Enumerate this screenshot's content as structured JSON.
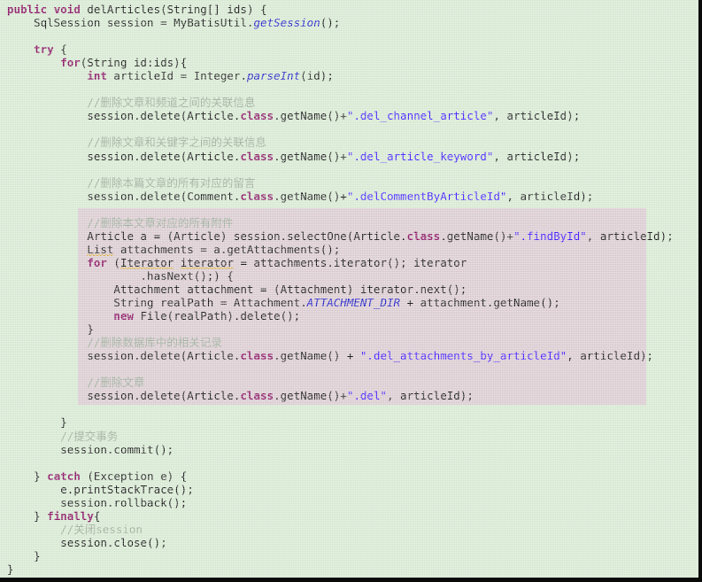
{
  "editor": {
    "language": "Java",
    "background_color": "#d2e6cd",
    "highlight_color": "#d6c6cc",
    "keyword_color": "#7f0055",
    "comment_color": "#90a48f",
    "string_color": "#2a00ff",
    "static_field_color": "#0000c0"
  },
  "code": {
    "lines": [
      {
        "id": 1,
        "indent": 0,
        "highlight": false,
        "tokens": [
          {
            "t": "kw",
            "v": "public"
          },
          {
            "t": "plain",
            "v": " "
          },
          {
            "t": "kw",
            "v": "void"
          },
          {
            "t": "plain",
            "v": " delArticles(String[] ids) {"
          }
        ]
      },
      {
        "id": 2,
        "indent": 1,
        "highlight": false,
        "tokens": [
          {
            "t": "plain",
            "v": "SqlSession session = MyBatisUtil."
          },
          {
            "t": "static",
            "v": "getSession"
          },
          {
            "t": "plain",
            "v": "();"
          }
        ]
      },
      {
        "id": 3,
        "indent": 0,
        "highlight": false,
        "tokens": []
      },
      {
        "id": 4,
        "indent": 1,
        "highlight": false,
        "tokens": [
          {
            "t": "kw",
            "v": "try"
          },
          {
            "t": "plain",
            "v": " {"
          }
        ]
      },
      {
        "id": 5,
        "indent": 2,
        "highlight": false,
        "tokens": [
          {
            "t": "kw",
            "v": "for"
          },
          {
            "t": "plain",
            "v": "(String id:ids){"
          }
        ]
      },
      {
        "id": 6,
        "indent": 3,
        "highlight": false,
        "tokens": [
          {
            "t": "kw",
            "v": "int"
          },
          {
            "t": "plain",
            "v": " articleId = Integer."
          },
          {
            "t": "static",
            "v": "parseInt"
          },
          {
            "t": "plain",
            "v": "(id);"
          }
        ]
      },
      {
        "id": 7,
        "indent": 0,
        "highlight": false,
        "tokens": []
      },
      {
        "id": 8,
        "indent": 3,
        "highlight": false,
        "tokens": [
          {
            "t": "cmt",
            "v": "//删除文章和频道之间的关联信息"
          }
        ]
      },
      {
        "id": 9,
        "indent": 3,
        "highlight": false,
        "tokens": [
          {
            "t": "plain",
            "v": "session.delete(Article."
          },
          {
            "t": "kw",
            "v": "class"
          },
          {
            "t": "plain",
            "v": ".getName()+"
          },
          {
            "t": "str",
            "v": "\".del_channel_article\""
          },
          {
            "t": "plain",
            "v": ", articleId);"
          }
        ]
      },
      {
        "id": 10,
        "indent": 0,
        "highlight": false,
        "tokens": []
      },
      {
        "id": 11,
        "indent": 3,
        "highlight": false,
        "tokens": [
          {
            "t": "cmt",
            "v": "//删除文章和关键字之间的关联信息"
          }
        ]
      },
      {
        "id": 12,
        "indent": 3,
        "highlight": false,
        "tokens": [
          {
            "t": "plain",
            "v": "session.delete(Article."
          },
          {
            "t": "kw",
            "v": "class"
          },
          {
            "t": "plain",
            "v": ".getName()+"
          },
          {
            "t": "str",
            "v": "\".del_article_keyword\""
          },
          {
            "t": "plain",
            "v": ", articleId);"
          }
        ]
      },
      {
        "id": 13,
        "indent": 0,
        "highlight": false,
        "tokens": []
      },
      {
        "id": 14,
        "indent": 3,
        "highlight": false,
        "tokens": [
          {
            "t": "cmt",
            "v": "//删除本篇文章的所有对应的留言"
          }
        ]
      },
      {
        "id": 15,
        "indent": 3,
        "highlight": false,
        "tokens": [
          {
            "t": "plain",
            "v": "session.delete(Comment."
          },
          {
            "t": "kw",
            "v": "class"
          },
          {
            "t": "plain",
            "v": ".getName()+"
          },
          {
            "t": "str",
            "v": "\".delCommentByArticleId\""
          },
          {
            "t": "plain",
            "v": ", articleId);"
          }
        ]
      },
      {
        "id": 16,
        "indent": 0,
        "highlight": true,
        "tokens": []
      },
      {
        "id": 17,
        "indent": 3,
        "highlight": true,
        "tokens": [
          {
            "t": "cmt",
            "v": "//删除本文章对应的所有附件"
          }
        ]
      },
      {
        "id": 18,
        "indent": 3,
        "highlight": true,
        "tokens": [
          {
            "t": "plain",
            "v": "Article a = (Article) session.selectOne(Article."
          },
          {
            "t": "kw",
            "v": "class"
          },
          {
            "t": "plain",
            "v": ".getName()+"
          },
          {
            "t": "str",
            "v": "\".findById\""
          },
          {
            "t": "plain",
            "v": ", articleId);"
          }
        ]
      },
      {
        "id": 19,
        "indent": 3,
        "highlight": true,
        "tokens": [
          {
            "t": "warn",
            "v": "List"
          },
          {
            "t": "plain",
            "v": " attachments = a.getAttachments();"
          }
        ]
      },
      {
        "id": 20,
        "indent": 3,
        "highlight": true,
        "tokens": [
          {
            "t": "kw",
            "v": "for"
          },
          {
            "t": "plain",
            "v": " ("
          },
          {
            "t": "warn",
            "v": "Iterator"
          },
          {
            "t": "plain",
            "v": " "
          },
          {
            "t": "warn",
            "v": "iterator"
          },
          {
            "t": "plain",
            "v": " = attachments.iterator(); iterator"
          }
        ]
      },
      {
        "id": 21,
        "indent": 5,
        "highlight": true,
        "tokens": [
          {
            "t": "plain",
            "v": ".hasNext();) {"
          }
        ]
      },
      {
        "id": 22,
        "indent": 4,
        "highlight": true,
        "tokens": [
          {
            "t": "plain",
            "v": "Attachment attachment = (Attachment) iterator.next();"
          }
        ]
      },
      {
        "id": 23,
        "indent": 4,
        "highlight": true,
        "tokens": [
          {
            "t": "plain",
            "v": "String realPath = Attachment."
          },
          {
            "t": "static",
            "v": "ATTACHMENT_DIR"
          },
          {
            "t": "plain",
            "v": " + attachment.getName();"
          }
        ]
      },
      {
        "id": 24,
        "indent": 4,
        "highlight": true,
        "tokens": [
          {
            "t": "kw",
            "v": "new"
          },
          {
            "t": "plain",
            "v": " File(realPath).delete();"
          }
        ]
      },
      {
        "id": 25,
        "indent": 3,
        "highlight": true,
        "tokens": [
          {
            "t": "plain",
            "v": "}"
          }
        ]
      },
      {
        "id": 26,
        "indent": 3,
        "highlight": true,
        "tokens": [
          {
            "t": "cmt",
            "v": "//删除数据库中的相关记录"
          }
        ]
      },
      {
        "id": 27,
        "indent": 3,
        "highlight": true,
        "tokens": [
          {
            "t": "plain",
            "v": "session.delete(Article."
          },
          {
            "t": "kw",
            "v": "class"
          },
          {
            "t": "plain",
            "v": ".getName() + "
          },
          {
            "t": "str",
            "v": "\".del_attachments_by_articleId\""
          },
          {
            "t": "plain",
            "v": ", articleId);"
          }
        ]
      },
      {
        "id": 28,
        "indent": 0,
        "highlight": true,
        "tokens": []
      },
      {
        "id": 29,
        "indent": 3,
        "highlight": true,
        "tokens": [
          {
            "t": "cmt",
            "v": "//删除文章"
          }
        ]
      },
      {
        "id": 30,
        "indent": 3,
        "highlight": true,
        "tokens": [
          {
            "t": "plain",
            "v": "session.delete(Article."
          },
          {
            "t": "kw",
            "v": "class"
          },
          {
            "t": "plain",
            "v": ".getName()+"
          },
          {
            "t": "str",
            "v": "\".del\""
          },
          {
            "t": "plain",
            "v": ", articleId);"
          }
        ]
      },
      {
        "id": 31,
        "indent": 0,
        "highlight": false,
        "tokens": []
      },
      {
        "id": 32,
        "indent": 2,
        "highlight": false,
        "tokens": [
          {
            "t": "plain",
            "v": "}"
          }
        ]
      },
      {
        "id": 33,
        "indent": 2,
        "highlight": false,
        "tokens": [
          {
            "t": "cmt",
            "v": "//提交事务"
          }
        ]
      },
      {
        "id": 34,
        "indent": 2,
        "highlight": false,
        "tokens": [
          {
            "t": "plain",
            "v": "session.commit();"
          }
        ]
      },
      {
        "id": 35,
        "indent": 0,
        "highlight": false,
        "tokens": []
      },
      {
        "id": 36,
        "indent": 1,
        "highlight": false,
        "tokens": [
          {
            "t": "plain",
            "v": "} "
          },
          {
            "t": "kw",
            "v": "catch"
          },
          {
            "t": "plain",
            "v": " (Exception e) {"
          }
        ]
      },
      {
        "id": 37,
        "indent": 2,
        "highlight": false,
        "tokens": [
          {
            "t": "plain",
            "v": "e.printStackTrace();"
          }
        ]
      },
      {
        "id": 38,
        "indent": 2,
        "highlight": false,
        "tokens": [
          {
            "t": "plain",
            "v": "session.rollback();"
          }
        ]
      },
      {
        "id": 39,
        "indent": 1,
        "highlight": false,
        "tokens": [
          {
            "t": "plain",
            "v": "} "
          },
          {
            "t": "kw",
            "v": "finally"
          },
          {
            "t": "plain",
            "v": "{"
          }
        ]
      },
      {
        "id": 40,
        "indent": 2,
        "highlight": false,
        "tokens": [
          {
            "t": "cmt",
            "v": "//关闭session"
          }
        ]
      },
      {
        "id": 41,
        "indent": 2,
        "highlight": false,
        "tokens": [
          {
            "t": "plain",
            "v": "session.close();"
          }
        ]
      },
      {
        "id": 42,
        "indent": 1,
        "highlight": false,
        "tokens": [
          {
            "t": "plain",
            "v": "}"
          }
        ]
      },
      {
        "id": 43,
        "indent": 0,
        "highlight": false,
        "tokens": [
          {
            "t": "plain",
            "v": "}"
          }
        ]
      }
    ]
  }
}
